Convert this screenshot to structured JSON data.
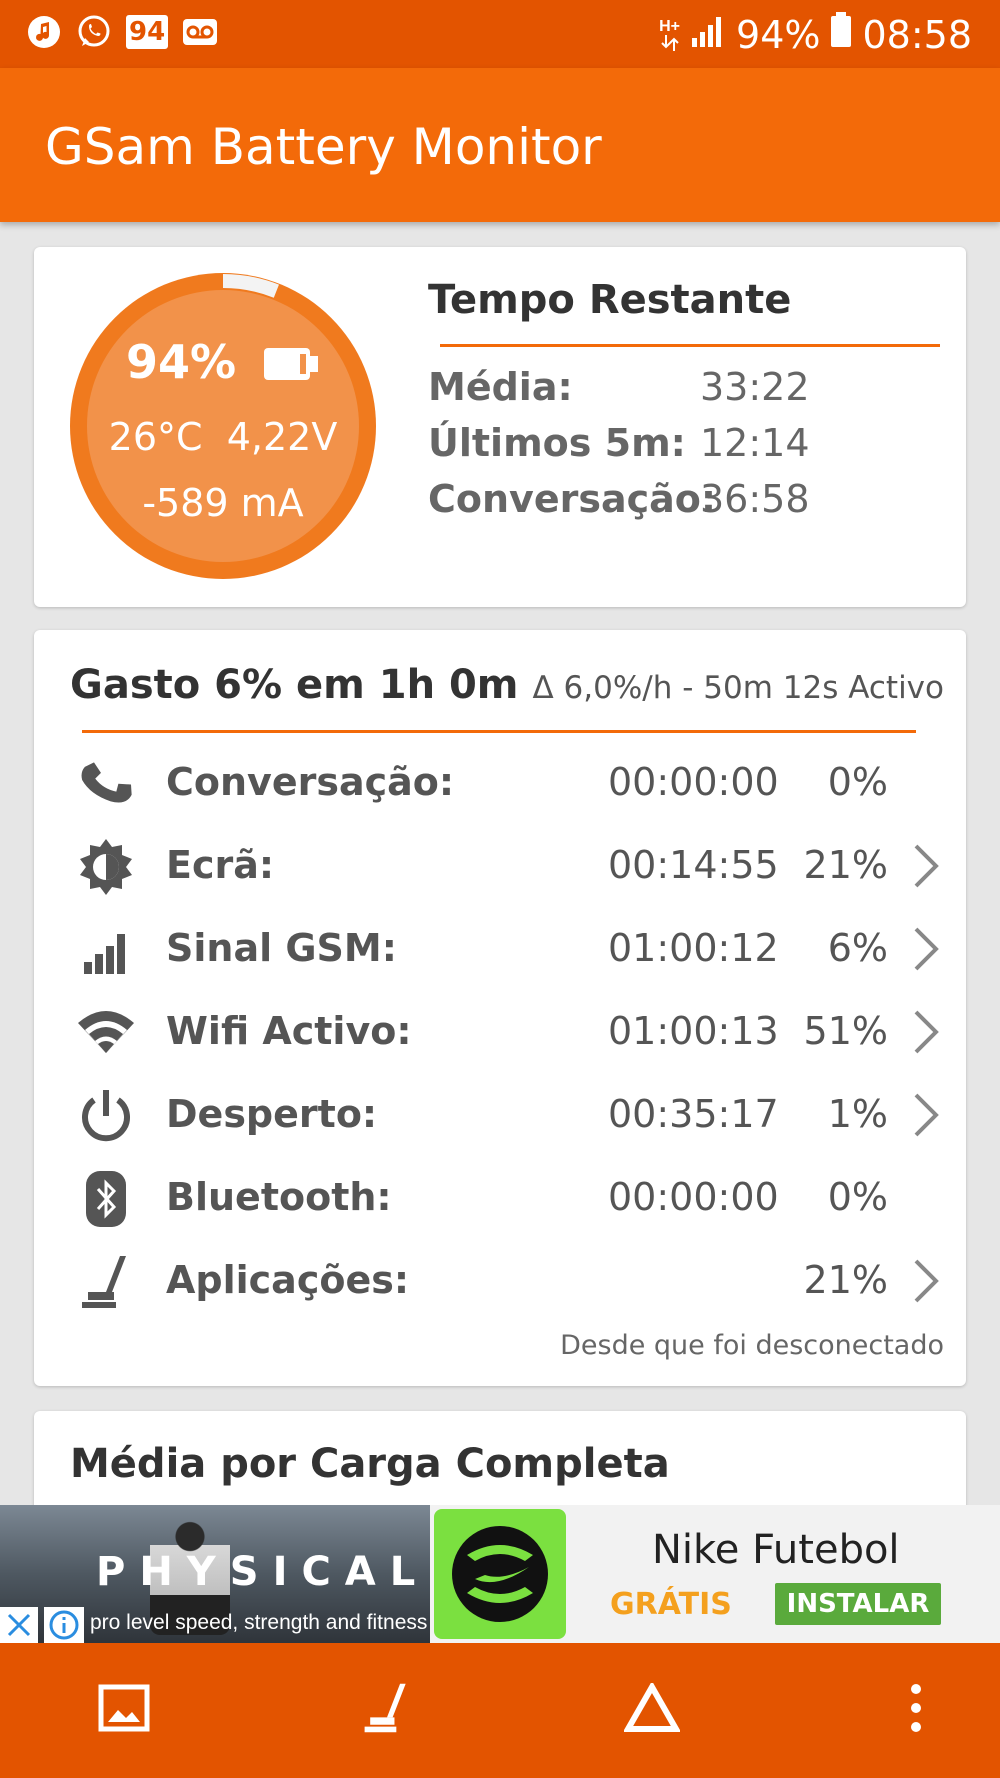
{
  "status_bar": {
    "notification_badge": "94",
    "network_type": "H+",
    "battery_percent": "94%",
    "time": "08:58"
  },
  "app": {
    "title": "GSam Battery Monitor"
  },
  "battery_card": {
    "percent": "94%",
    "level_fraction": 0.94,
    "temperature": "26°C",
    "voltage": "4,22V",
    "current": "-589 mA",
    "remaining": {
      "title": "Tempo Restante",
      "rows": [
        {
          "label": "Média:",
          "value": "33:22"
        },
        {
          "label": "Últimos 5m:",
          "value": "12:14"
        },
        {
          "label": "Conversação:",
          "value": "36:58"
        }
      ]
    }
  },
  "usage_card": {
    "title": "Gasto 6% em 1h 0m",
    "rate": "Δ 6,0%/h - 50m 12s Activo",
    "rows": [
      {
        "icon": "phone-icon",
        "label": "Conversação:",
        "time": "00:00:00",
        "percent": "0%",
        "has_detail": false
      },
      {
        "icon": "screen-brightness-icon",
        "label": "Ecrã:",
        "time": "00:14:55",
        "percent": "21%",
        "has_detail": true
      },
      {
        "icon": "signal-bars-icon",
        "label": "Sinal GSM:",
        "time": "01:00:12",
        "percent": "6%",
        "has_detail": true
      },
      {
        "icon": "wifi-icon",
        "label": "Wifi Activo:",
        "time": "01:00:13",
        "percent": "51%",
        "has_detail": true
      },
      {
        "icon": "power-icon",
        "label": "Desperto:",
        "time": "00:35:17",
        "percent": "1%",
        "has_detail": true
      },
      {
        "icon": "bluetooth-icon",
        "label": "Bluetooth:",
        "time": "00:00:00",
        "percent": "0%",
        "has_detail": false
      },
      {
        "icon": "apps-icon",
        "label": "Aplicações:",
        "time": "",
        "percent": "21%",
        "has_detail": true
      }
    ],
    "footer": "Desde que foi desconectado"
  },
  "average_card": {
    "title": "Média por Carga Completa"
  },
  "ad": {
    "headline": "PHYSICAL",
    "subline": "pro level speed, strength and fitness",
    "app_name": "Nike Futebol",
    "price": "GRÁTIS",
    "install_label": "INSTALAR"
  },
  "bottom_bar": {
    "icons": [
      "image-icon",
      "apps-icon",
      "delta-icon",
      "more-vert-icon"
    ]
  },
  "colors": {
    "status_bar": "#e35400",
    "app_bar": "#f36a09",
    "accent": "#f36a09",
    "install_button": "#5aaa3c",
    "price": "#f4a01e"
  }
}
